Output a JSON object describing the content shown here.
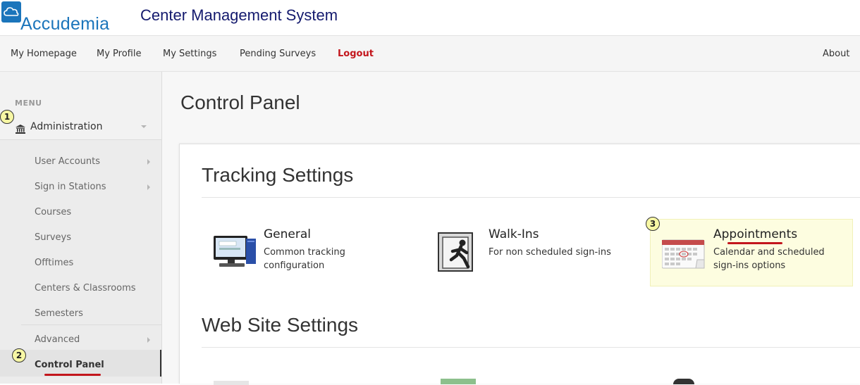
{
  "header": {
    "logo_text": "Accudemia",
    "app_title": "Center Management System"
  },
  "nav": {
    "items": [
      "My Homepage",
      "My Profile",
      "My Settings",
      "Pending Surveys"
    ],
    "logout": "Logout",
    "about": "About"
  },
  "sidebar": {
    "menu_label": "MENU",
    "admin_label": "Administration",
    "items": [
      {
        "label": "User Accounts"
      },
      {
        "label": "Sign in Stations"
      },
      {
        "label": "Courses"
      },
      {
        "label": "Surveys"
      },
      {
        "label": "Offtimes"
      },
      {
        "label": "Centers & Classrooms"
      },
      {
        "label": "Semesters"
      },
      {
        "label": "Advanced"
      },
      {
        "label": "Control Panel"
      }
    ]
  },
  "callouts": [
    "1",
    "2",
    "3"
  ],
  "main": {
    "page_title": "Control Panel",
    "tracking": {
      "title": "Tracking Settings",
      "items": [
        {
          "title": "General",
          "desc1": "Common tracking",
          "desc2": "configuration",
          "icon": "computer-icon"
        },
        {
          "title": "Walk-Ins",
          "desc1": "For non scheduled sign-ins",
          "desc2": "",
          "icon": "door-walkin-icon"
        },
        {
          "title": "Appointments",
          "desc1": "Calendar and scheduled",
          "desc2": "sign-ins options",
          "icon": "calendar-icon"
        }
      ]
    },
    "website": {
      "title": "Web Site Settings"
    }
  },
  "colors": {
    "brand_blue": "#1b75bb",
    "title_navy": "#141a6e",
    "logout_red": "#c3161c",
    "highlight_yellow": "#fdfde0"
  }
}
